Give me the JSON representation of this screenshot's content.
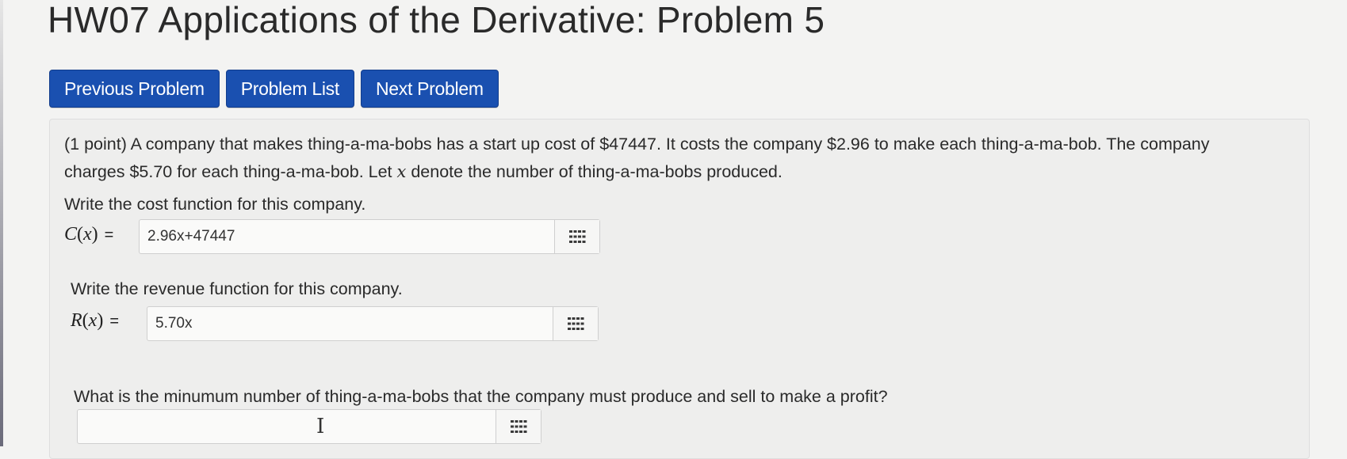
{
  "page": {
    "title": "HW07 Applications of the Derivative: Problem 5"
  },
  "nav": {
    "previous_label": "Previous Problem",
    "list_label": "Problem List",
    "next_label": "Next Problem"
  },
  "problem": {
    "intro_line1": "(1 point) A company that makes thing-a-ma-bobs has a start up cost of $47447. It costs the company $2.96 to make each thing-a-ma-bob. The company",
    "intro_line2_before": "charges $5.70 for each thing-a-ma-bob. Let ",
    "variable": "x",
    "intro_line2_after": " denote the number of thing-a-ma-bobs produced.",
    "cost": {
      "question": "Write the cost function for this company.",
      "fn_name": "C",
      "fn_arg": "x",
      "value": "2.96x+47447"
    },
    "revenue": {
      "question": "Write the revenue function for this company.",
      "fn_name": "R",
      "fn_arg": "x",
      "value": "5.70x"
    },
    "profit": {
      "question": "What is the minumum number of thing-a-ma-bobs that the company must produce and sell to make a profit?",
      "value": ""
    }
  },
  "icons": {
    "equation_editor": "grid-icon",
    "text_cursor": "text-cursor-icon"
  }
}
